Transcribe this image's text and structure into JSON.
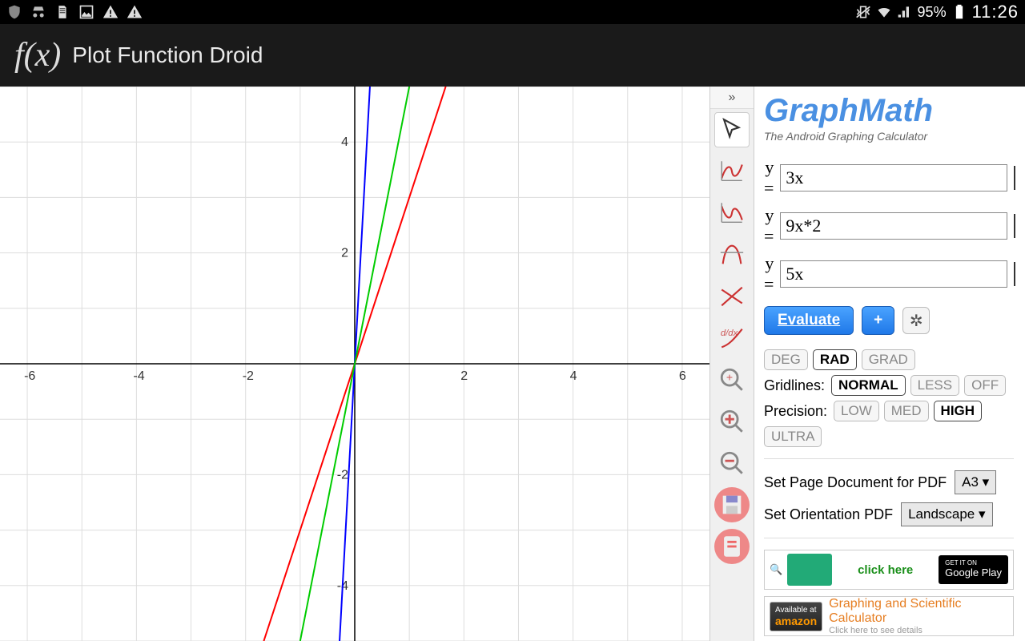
{
  "statusbar": {
    "battery": "95%",
    "time": "11:26"
  },
  "titlebar": {
    "title": "Plot Function Droid",
    "icon_text": "f(x)"
  },
  "chart_data": {
    "type": "line",
    "title": "",
    "xlabel": "",
    "ylabel": "",
    "xlim": [
      -6.5,
      6.5
    ],
    "ylim": [
      -5,
      5
    ],
    "xticks": [
      -6,
      -4,
      -2,
      2,
      4,
      6
    ],
    "yticks": [
      -4,
      -2,
      2,
      4
    ],
    "grid": true,
    "series": [
      {
        "name": "3x",
        "color": "#ff0000",
        "points": [
          [
            -1.667,
            -5
          ],
          [
            1.667,
            5
          ]
        ]
      },
      {
        "name": "9x*2",
        "color": "#0000ff",
        "points": [
          [
            -0.278,
            -5
          ],
          [
            0.278,
            5
          ]
        ]
      },
      {
        "name": "5x",
        "color": "#00cc00",
        "points": [
          [
            -1,
            -5
          ],
          [
            1,
            5
          ]
        ]
      }
    ]
  },
  "panel": {
    "brand": "GraphMath",
    "tagline": "The Android Graphing Calculator",
    "equations": [
      {
        "label": "y =",
        "value": "3x",
        "color": "#ff0000"
      },
      {
        "label": "y =",
        "value": "9x*2",
        "color": "#0000ff"
      },
      {
        "label": "y =",
        "value": "5x",
        "color": "#00ff00"
      }
    ],
    "evaluate": "Evaluate",
    "add": "+",
    "angle": {
      "options": [
        "DEG",
        "RAD",
        "GRAD"
      ],
      "selected": "RAD"
    },
    "gridlines": {
      "label": "Gridlines:",
      "options": [
        "NORMAL",
        "LESS",
        "OFF"
      ],
      "selected": "NORMAL"
    },
    "precision": {
      "label": "Precision:",
      "options": [
        "LOW",
        "MED",
        "HIGH",
        "ULTRA"
      ],
      "selected": "HIGH"
    },
    "pdf_page": {
      "label": "Set Page Document for PDF",
      "value": "A3 ▾"
    },
    "pdf_orient": {
      "label": "Set Orientation PDF",
      "value": "Landscape ▾"
    },
    "ad_play": {
      "cta": "click here",
      "badge_top": "GET IT ON",
      "badge_bot": "Google Play"
    },
    "ad_amz": {
      "badge_top": "Available at",
      "badge_bot": "amazon",
      "title": "Graphing and Scientific Calculator",
      "sub": "Click here to see details"
    }
  }
}
